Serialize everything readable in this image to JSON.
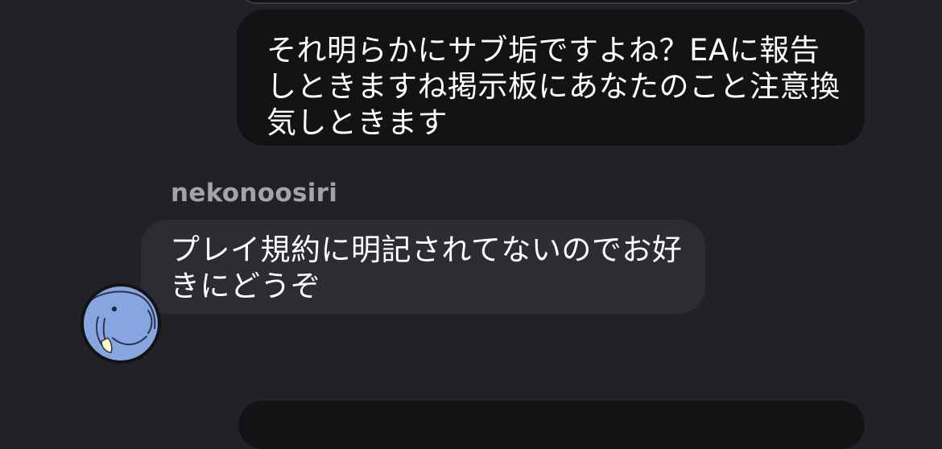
{
  "chat": {
    "messages": [
      {
        "direction": "sent",
        "text": "それ明らかにサブ垢ですよね？EAに報告しときますね掲示板にあなたのこと注意換気しときます"
      },
      {
        "direction": "received",
        "sender": "nekonoosiri",
        "text": "プレイ規約に明記されてないのでお好きにどうぞ"
      }
    ]
  }
}
